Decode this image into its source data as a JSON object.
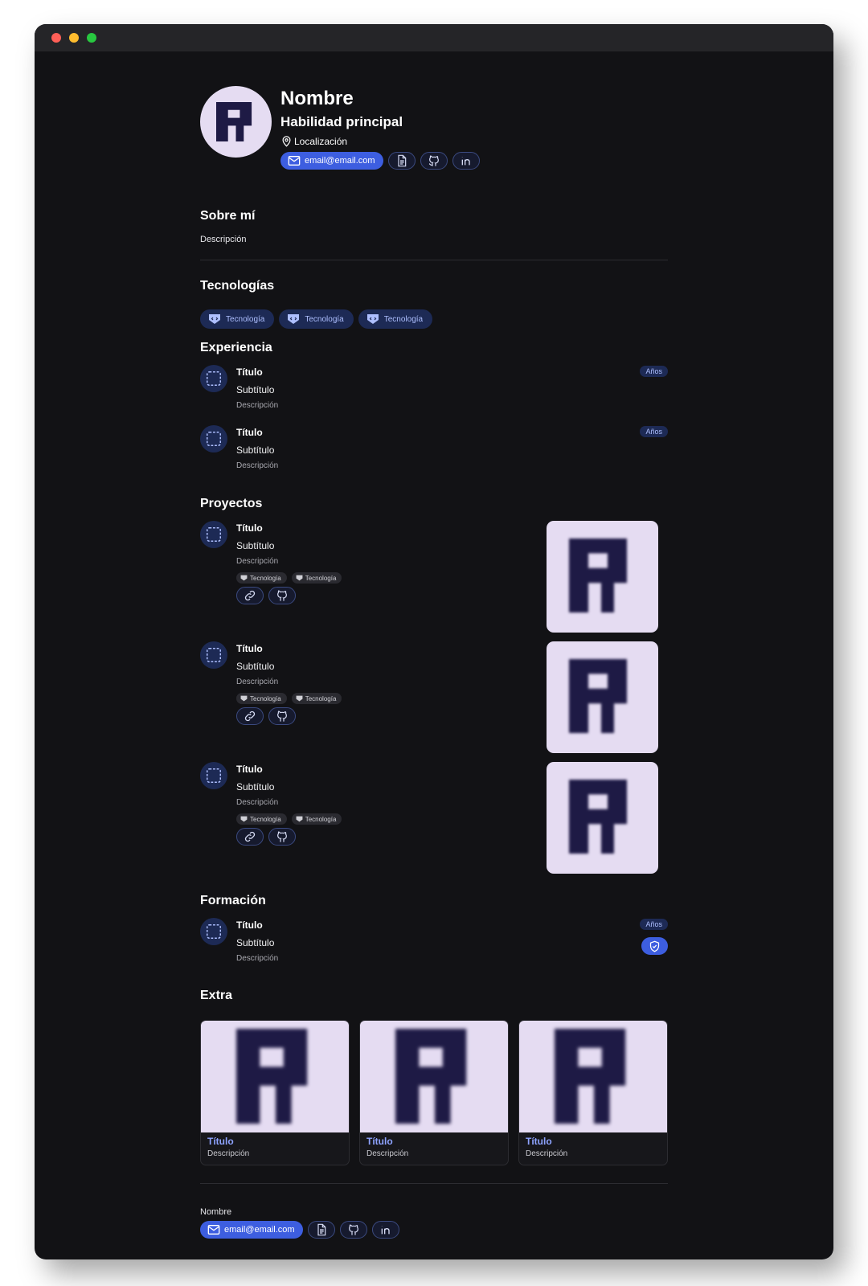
{
  "window": {
    "controls": [
      "close",
      "minimize",
      "zoom"
    ]
  },
  "profile": {
    "name": "Nombre",
    "skill": "Habilidad principal",
    "location": "Localización",
    "email": "email@email.com",
    "links": [
      "document-icon",
      "github-icon",
      "linkedin-icon"
    ]
  },
  "about": {
    "heading": "Sobre mí",
    "description": "Descripción"
  },
  "technologies": {
    "heading": "Tecnologías",
    "items": [
      "Tecnología",
      "Tecnología",
      "Tecnología"
    ]
  },
  "experience": {
    "heading": "Experiencia",
    "items": [
      {
        "title": "Título",
        "subtitle": "Subtítulo",
        "description": "Descripción",
        "years": "Años"
      },
      {
        "title": "Título",
        "subtitle": "Subtítulo",
        "description": "Descripción",
        "years": "Años"
      }
    ]
  },
  "projects": {
    "heading": "Proyectos",
    "items": [
      {
        "title": "Título",
        "subtitle": "Subtítulo",
        "description": "Descripción",
        "tech": [
          "Tecnología",
          "Tecnología"
        ]
      },
      {
        "title": "Título",
        "subtitle": "Subtítulo",
        "description": "Descripción",
        "tech": [
          "Tecnología",
          "Tecnología"
        ]
      },
      {
        "title": "Título",
        "subtitle": "Subtítulo",
        "description": "Descripción",
        "tech": [
          "Tecnología",
          "Tecnología"
        ]
      }
    ]
  },
  "education": {
    "heading": "Formación",
    "items": [
      {
        "title": "Título",
        "subtitle": "Subtítulo",
        "description": "Descripción",
        "years": "Años"
      }
    ]
  },
  "extra": {
    "heading": "Extra",
    "items": [
      {
        "title": "Título",
        "description": "Descripción"
      },
      {
        "title": "Título",
        "description": "Descripción"
      },
      {
        "title": "Título",
        "description": "Descripción"
      }
    ]
  },
  "footer": {
    "name": "Nombre",
    "email": "email@email.com"
  },
  "colors": {
    "background": "#121215",
    "accent": "#3d5ee0",
    "pill": "#1d2a55",
    "logo_bg": "#e5dcf2",
    "logo_fg": "#1e1a45"
  }
}
